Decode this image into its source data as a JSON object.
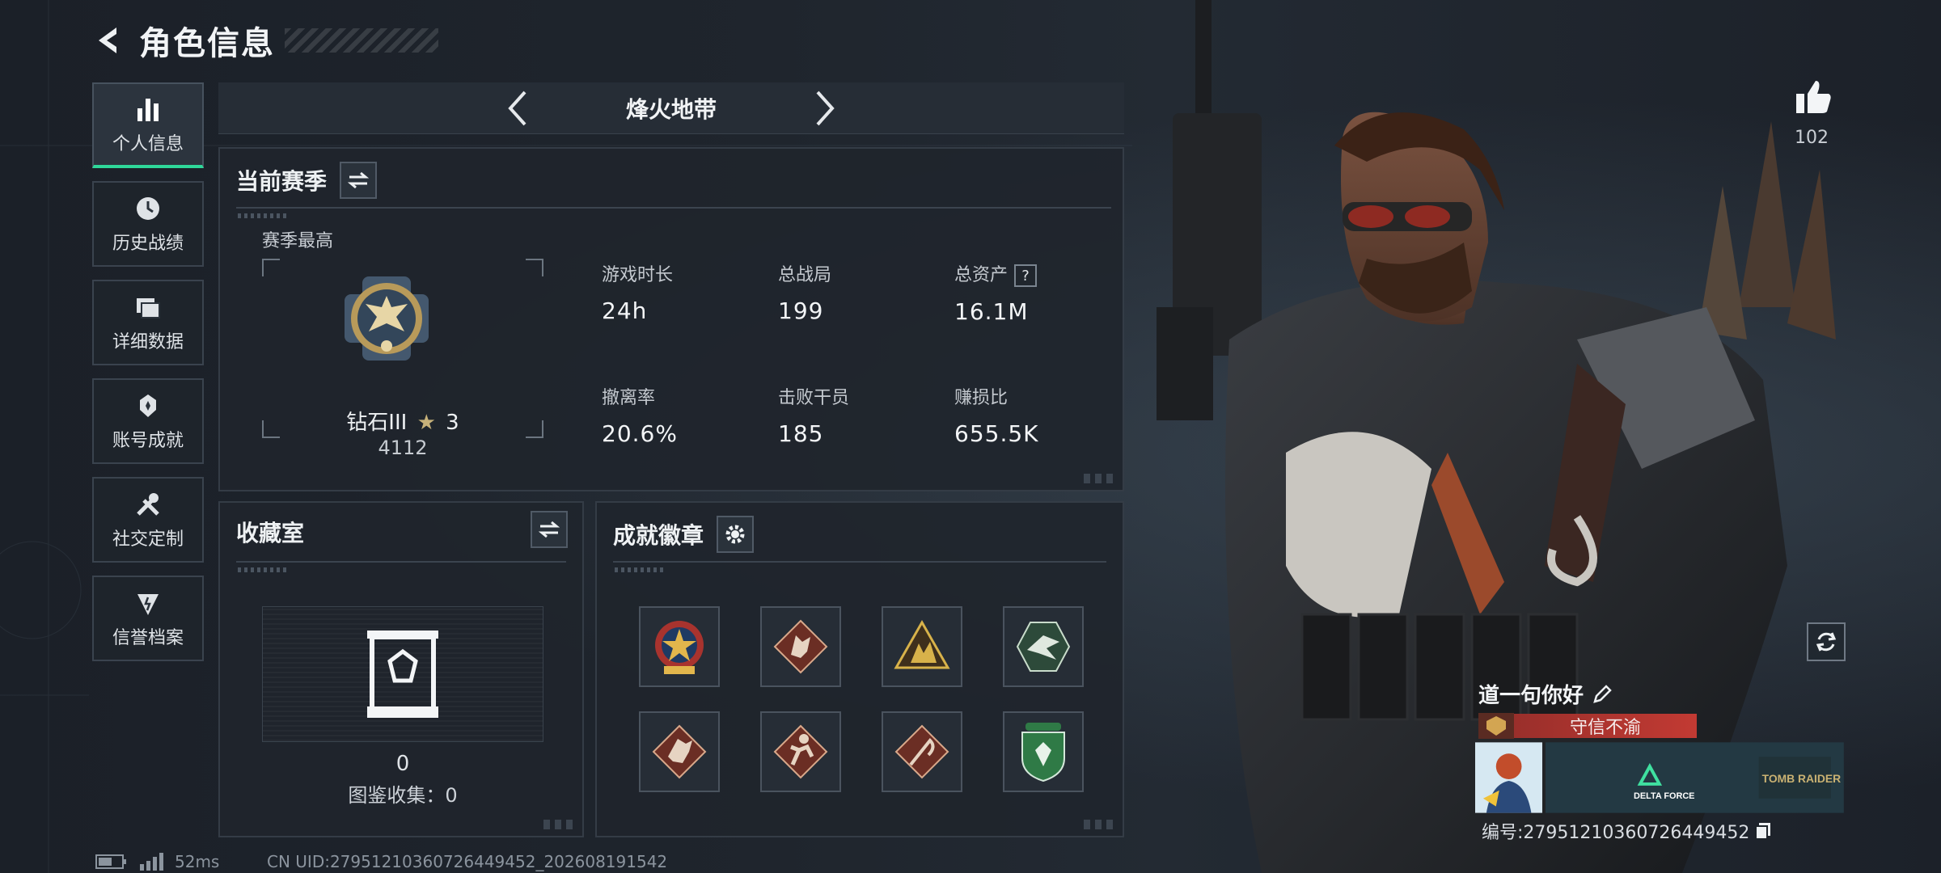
{
  "header": {
    "title": "角色信息"
  },
  "sidebar": {
    "items": [
      {
        "label": "个人信息",
        "icon": "bar-chart-icon",
        "active": true
      },
      {
        "label": "历史战绩",
        "icon": "history-clock-icon"
      },
      {
        "label": "详细数据",
        "icon": "folders-icon"
      },
      {
        "label": "账号成就",
        "icon": "achievement-icon"
      },
      {
        "label": "社交定制",
        "icon": "tools-icon"
      },
      {
        "label": "信誉档案",
        "icon": "reputation-icon"
      }
    ]
  },
  "mode": {
    "title": "烽火地带"
  },
  "season": {
    "title": "当前赛季",
    "best_label": "赛季最高",
    "rank_name": "钻石III",
    "rank_stars": "3",
    "rank_score": "4112",
    "stats": [
      {
        "label": "游戏时长",
        "value": "24h"
      },
      {
        "label": "总战局",
        "value": "199"
      },
      {
        "label": "总资产",
        "value": "16.1M",
        "help": "?"
      },
      {
        "label": "撤离率",
        "value": "20.6%"
      },
      {
        "label": "击败干员",
        "value": "185"
      },
      {
        "label": "赚损比",
        "value": "655.5K"
      }
    ]
  },
  "collection": {
    "title": "收藏室",
    "count": "0",
    "label": "图鉴收集：0"
  },
  "badges": {
    "title": "成就徽章",
    "items": [
      "star-emblem-badge",
      "wolf-badge",
      "mountain-badge",
      "eagle-badge",
      "dragon-badge",
      "runner-badge",
      "scythe-badge",
      "shield-badge"
    ]
  },
  "profile": {
    "likes": "102",
    "greeting": "道一句你好",
    "reputation": "守信不渝",
    "uid_line": "编号:2795121036072644945​2",
    "card_logo_text": "DELTA FORCE",
    "card_logo_text2": "TOMB RAIDER"
  },
  "status": {
    "ping": "52ms",
    "cn_uid": "CN UID:2795121036072644945​2_202608191542"
  },
  "colors": {
    "accent": "#2fd89a",
    "reputation": "#c23a33",
    "panel": "#1f252d"
  }
}
